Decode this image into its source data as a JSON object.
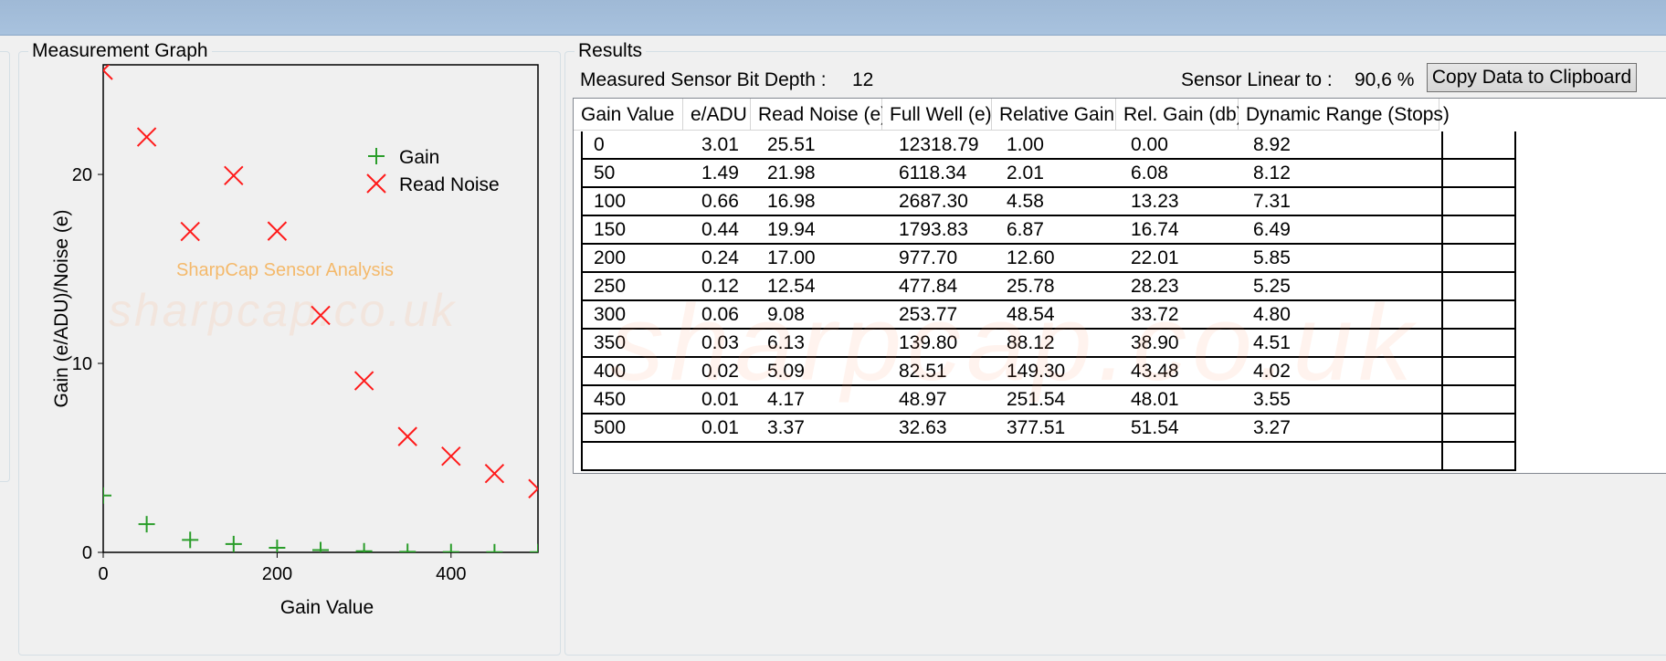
{
  "graph_panel": {
    "title": "Measurement Graph",
    "watermark_url": "sharpcap.co.uk",
    "watermark_caption": "SharpCap Sensor Analysis"
  },
  "results_panel": {
    "title": "Results",
    "bit_depth_label": "Measured Sensor Bit Depth :",
    "bit_depth_value": "12",
    "linear_label": "Sensor Linear to :",
    "linear_value": "90,6 %",
    "copy_button_label": "Copy Data to Clipboard",
    "watermark": "sharpcap.co.uk"
  },
  "table": {
    "columns": [
      "Gain Value",
      "e/ADU",
      "Read Noise (e)",
      "Full Well (e)",
      "Relative Gain",
      "Rel. Gain (db)",
      "Dynamic Range (Stops)"
    ],
    "rows": [
      [
        "0",
        "3.01",
        "25.51",
        "12318.79",
        "1.00",
        "0.00",
        "8.92"
      ],
      [
        "50",
        "1.49",
        "21.98",
        "6118.34",
        "2.01",
        "6.08",
        "8.12"
      ],
      [
        "100",
        "0.66",
        "16.98",
        "2687.30",
        "4.58",
        "13.23",
        "7.31"
      ],
      [
        "150",
        "0.44",
        "19.94",
        "1793.83",
        "6.87",
        "16.74",
        "6.49"
      ],
      [
        "200",
        "0.24",
        "17.00",
        "977.70",
        "12.60",
        "22.01",
        "5.85"
      ],
      [
        "250",
        "0.12",
        "12.54",
        "477.84",
        "25.78",
        "28.23",
        "5.25"
      ],
      [
        "300",
        "0.06",
        "9.08",
        "253.77",
        "48.54",
        "33.72",
        "4.80"
      ],
      [
        "350",
        "0.03",
        "6.13",
        "139.80",
        "88.12",
        "38.90",
        "4.51"
      ],
      [
        "400",
        "0.02",
        "5.09",
        "82.51",
        "149.30",
        "43.48",
        "4.02"
      ],
      [
        "450",
        "0.01",
        "4.17",
        "48.97",
        "251.54",
        "48.01",
        "3.55"
      ],
      [
        "500",
        "0.01",
        "3.37",
        "32.63",
        "377.51",
        "51.54",
        "3.27"
      ],
      [
        "",
        "",
        "",
        "",
        "",
        "",
        ""
      ]
    ]
  },
  "chart_data": {
    "type": "scatter",
    "xlabel": "Gain Value",
    "ylabel": "Gain (e/ADU)/Noise (e)",
    "xlim": [
      0,
      500
    ],
    "ylim": [
      0,
      25.8
    ],
    "xticks": [
      "0",
      "200",
      "400"
    ],
    "yticks": [
      "0",
      "10",
      "20"
    ],
    "grid": false,
    "legend_position": "top-right",
    "x": [
      0,
      50,
      100,
      150,
      200,
      250,
      300,
      350,
      400,
      450,
      500
    ],
    "series": [
      {
        "name": "Gain",
        "marker": "plus",
        "color": "#2a9d2a",
        "values": [
          3.01,
          1.49,
          0.66,
          0.44,
          0.24,
          0.12,
          0.06,
          0.03,
          0.02,
          0.01,
          0.01
        ]
      },
      {
        "name": "Read Noise",
        "marker": "x",
        "color": "#ff1a1a",
        "values": [
          25.51,
          21.98,
          16.98,
          19.94,
          17.0,
          12.54,
          9.08,
          6.13,
          5.09,
          4.17,
          3.37
        ]
      }
    ]
  }
}
